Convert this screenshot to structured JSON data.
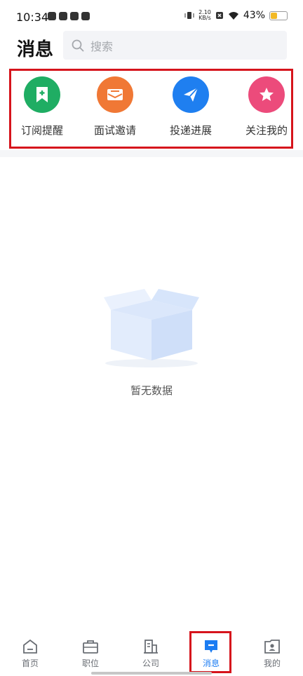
{
  "status_bar": {
    "time": "10:34",
    "net_speed_top": "2.10",
    "net_speed_bottom": "KB/s",
    "battery": "43%",
    "battery_level": 0.43
  },
  "header": {
    "title": "消息",
    "search_placeholder": "搜索"
  },
  "quick_entries": [
    {
      "label": "订阅提醒",
      "icon": "bookmark-plus-icon",
      "color": "#1fad63"
    },
    {
      "label": "面试邀请",
      "icon": "envelope-icon",
      "color": "#f07835"
    },
    {
      "label": "投递进展",
      "icon": "paper-plane-icon",
      "color": "#1f7ff0"
    },
    {
      "label": "关注我的",
      "icon": "star-icon",
      "color": "#ec4b7b"
    }
  ],
  "empty_state": {
    "text": "暂无数据",
    "icon": "empty-box-icon"
  },
  "tabbar": {
    "tabs": [
      {
        "label": "首页",
        "icon": "home-icon"
      },
      {
        "label": "职位",
        "icon": "briefcase-icon"
      },
      {
        "label": "公司",
        "icon": "building-icon"
      },
      {
        "label": "消息",
        "icon": "message-icon"
      },
      {
        "label": "我的",
        "icon": "profile-icon"
      }
    ],
    "active_color": "#1b7cf2"
  }
}
